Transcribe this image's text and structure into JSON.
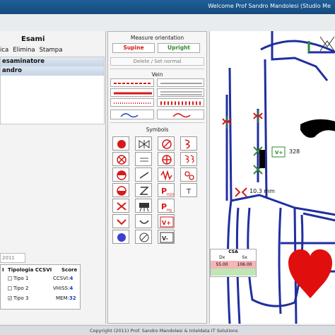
{
  "window": {
    "title": "Welcome Prof Sandro Mandolesi (Studio Me"
  },
  "left": {
    "title": "Esami",
    "menu": [
      "ica",
      "Elimina",
      "Stampa"
    ],
    "list": [
      "esaminatore",
      "andro"
    ],
    "date": "2011",
    "table": {
      "headers": [
        "I",
        "Tipologia CCSVI",
        "Score"
      ],
      "types": [
        "Tipo 1",
        "Tipo 2",
        "Tipo 3"
      ],
      "scores": [
        {
          "label": "CCSVI:",
          "value": "4"
        },
        {
          "label": "VHISS:",
          "value": "4"
        },
        {
          "label": "MEM:",
          "value": "32"
        }
      ]
    }
  },
  "middle": {
    "measure_title": "Measure orientation",
    "supine": "Supine",
    "upright": "Upright",
    "delete_label": "Delete / Set normal",
    "vein_title": "Vein",
    "symbols_title": "Symbols",
    "symbol_texts": {
      "h2o": "P",
      "h2o_sub": "H20",
      "hg": "P",
      "hg_sub": "Hg",
      "t": "T",
      "vplus": "V+",
      "vminus": "V-"
    }
  },
  "right": {
    "value_328": "328",
    "vplus_label": "V+",
    "mm_label": "10.3 mm",
    "csa": {
      "title": "CSA",
      "dx": "Dx",
      "sx": "Sx",
      "row1_dx": "55.00",
      "row1_sx": "106.00",
      "row2_dx": "",
      "row2_sx": ""
    }
  },
  "colors": {
    "title_bar": "#1b5690",
    "vein": "#1f2fa0",
    "red": "#d61a1a",
    "green": "#2f8b2f",
    "heart": "#e10e0e"
  },
  "footer": {
    "copyright": "Copyright (2011) Prof. Sandro Mandolesi & Inteldata IT Solutions"
  }
}
